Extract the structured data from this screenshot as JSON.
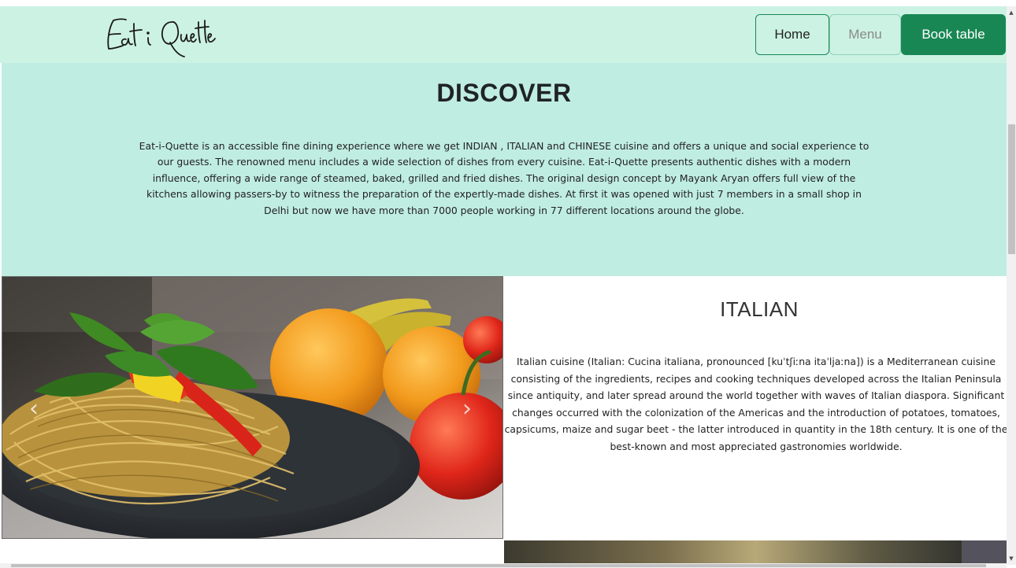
{
  "brand": {
    "logo_text": "Eat i Quette",
    "logo_icon": "script-logo"
  },
  "nav": {
    "home_label": "Home",
    "menu_label": "Menu",
    "book_label": "Book table",
    "colors": {
      "primary": "#198754",
      "header_bg": "#ccf2e4"
    }
  },
  "discover": {
    "title": "DISCOVER",
    "body": "Eat-i-Quette is an accessible fine dining experience where we get INDIAN , ITALIAN and CHINESE cuisine and offers a unique and social experience to our guests. The renowned menu includes a wide selection of dishes from every cuisine. Eat-i-Quette presents authentic dishes with a modern influence, offering a wide range of steamed, baked, grilled and fried dishes. The original design concept by Mayank Aryan offers full view of the kitchens allowing passers-by to witness the preparation of the expertly-made dishes. At first it was opened with just 7 members in a small shop in Delhi but now we have more than 7000 people working in 77 different locations around the globe.",
    "bg_color": "#c0ede1"
  },
  "carousel": {
    "prev_icon": "chevron-left-icon",
    "next_icon": "chevron-right-icon",
    "prev_glyph": "‹",
    "next_glyph": "›"
  },
  "italian": {
    "title": "ITALIAN",
    "body": "Italian cuisine (Italian: Cucina italiana, pronounced [kuˈtʃiːna itaˈljaːna]) is a Mediterranean cuisine consisting of the ingredients, recipes and cooking techniques developed across the Italian Peninsula since antiquity, and later spread around the world together with waves of Italian diaspora. Significant changes occurred with the colonization of the Americas and the introduction of potatoes, tomatoes, capsicums, maize and sugar beet - the latter introduced in quantity in the 18th century. It is one of the best-known and most appreciated gastronomies worldwide."
  },
  "scrollbar": {
    "up_glyph": "▲",
    "down_glyph": "▼"
  }
}
